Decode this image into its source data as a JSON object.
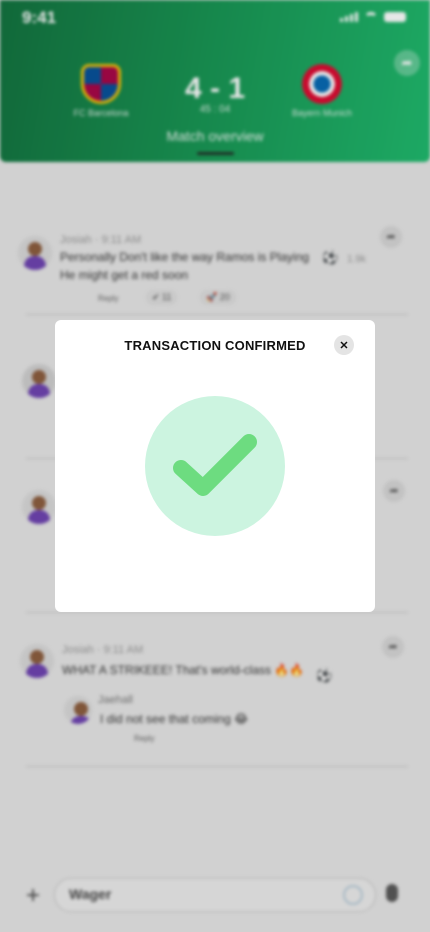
{
  "status_bar": {
    "time": "9:41"
  },
  "match": {
    "home_team": "FC Barcelona",
    "away_team": "Bayern Munich",
    "score": "4 - 1",
    "clock": "45 : 04",
    "tab_label": "Match overview"
  },
  "chat": {
    "messages": [
      {
        "user": "Josiah",
        "time": "9:11 AM",
        "text_line1": "Personally Don't like the way Ramos is Playing",
        "text_line2": "He might get a red soon",
        "reply_label": "Reply",
        "reaction_check_count": "11",
        "reaction_rocket_count": "20",
        "ball_count": "1.9k"
      },
      {
        "user": "Josiah",
        "time": "9:11 AM",
        "text": "WHAT A STRIKEEE! That's world-class 🔥🔥",
        "reply": {
          "user": "Jaehall",
          "text": "I did not see that coming 😂",
          "reply_label": "Reply"
        }
      }
    ]
  },
  "composer": {
    "input_value": "Wager"
  },
  "modal": {
    "title": "TRANSACTION CONFIRMED",
    "close_glyph": "✕",
    "check_color": "#6ddc80",
    "circle_color": "#ccf4e0"
  },
  "colors": {
    "header_green": "#12914e",
    "accent_green": "#19b96a"
  }
}
